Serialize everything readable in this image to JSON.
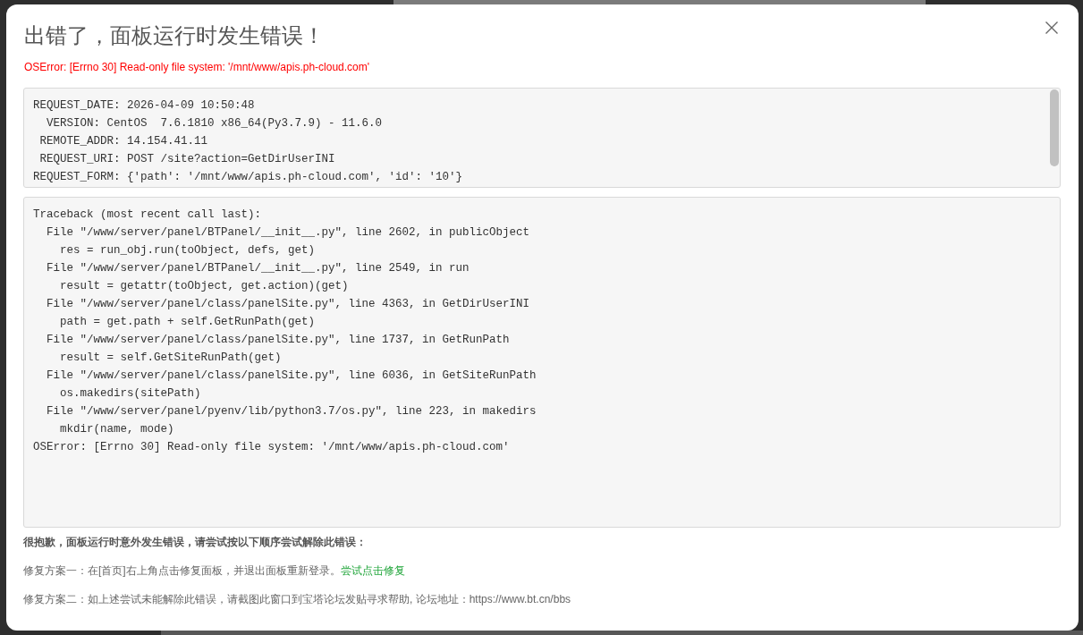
{
  "dialog": {
    "title": "出错了，面板运行时发生错误！",
    "error_message": "OSError: [Errno 30] Read-only file system: '/mnt/www/apis.ph-cloud.com'",
    "request_info": {
      "lines": [
        "REQUEST_DATE: 2026-04-09 10:50:48",
        "  VERSION: CentOS  7.6.1810 x86_64(Py3.7.9) - 11.6.0",
        " REMOTE_ADDR: 14.154.41.11",
        " REQUEST_URI: POST /site?action=GetDirUserINI",
        "REQUEST_FORM: {'path': '/mnt/www/apis.ph-cloud.com', 'id': '10'}"
      ]
    },
    "traceback": {
      "lines": [
        "Traceback (most recent call last):",
        "  File \"/www/server/panel/BTPanel/__init__.py\", line 2602, in publicObject",
        "    res = run_obj.run(toObject, defs, get)",
        "  File \"/www/server/panel/BTPanel/__init__.py\", line 2549, in run",
        "    result = getattr(toObject, get.action)(get)",
        "  File \"/www/server/panel/class/panelSite.py\", line 4363, in GetDirUserINI",
        "    path = get.path + self.GetRunPath(get)",
        "  File \"/www/server/panel/class/panelSite.py\", line 1737, in GetRunPath",
        "    result = self.GetSiteRunPath(get)",
        "  File \"/www/server/panel/class/panelSite.py\", line 6036, in GetSiteRunPath",
        "    os.makedirs(sitePath)",
        "  File \"/www/server/panel/pyenv/lib/python3.7/os.py\", line 223, in makedirs",
        "    mkdir(name, mode)",
        "OSError: [Errno 30] Read-only file system: '/mnt/www/apis.ph-cloud.com'"
      ]
    },
    "help": {
      "heading": "很抱歉，面板运行时意外发生错误，请尝试按以下顺序尝试解除此错误：",
      "fixes": [
        {
          "text": "修复方案一：在[首页]右上角点击修复面板，并退出面板重新登录。",
          "link": "尝试点击修复"
        },
        {
          "text": "修复方案二：如上述尝试未能解除此错误，请截图此窗口到宝塔论坛发贴寻求帮助, 论坛地址：https://www.bt.cn/bbs"
        }
      ]
    }
  }
}
